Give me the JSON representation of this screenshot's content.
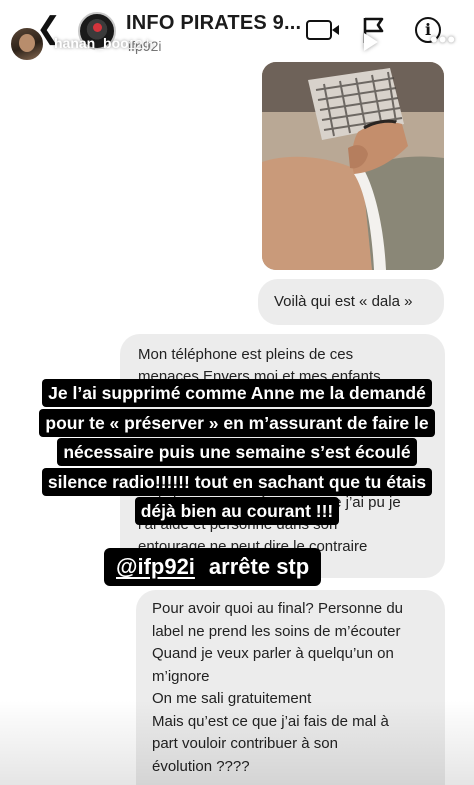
{
  "story": {
    "username": "hanan_boo",
    "time_label": "12 h",
    "progress_fraction": 1.0
  },
  "inner_chat": {
    "title": "INFO PIRATES 9...",
    "subtitle": "ifp92i"
  },
  "messages": {
    "dala": "Voilà qui est « dala »",
    "phone_top_1": "Mon téléphone est pleins de ces",
    "phone_top_2": "menaces Envers moi et mes enfants",
    "phone_bottom_1": "Je l’ai accompagné autant que j’ai pu je",
    "phone_bottom_2": "l’ai aidé et personne dans son",
    "phone_bottom_3": "entourage ne peut dire le contraire",
    "bottom_lines": [
      "Pour avoir quoi au final? Personne du",
      "label ne prend les soins de m’écouter",
      "Quand je veux parler à quelqu’un on",
      "m’ignore",
      "On me sali gratuitement",
      "Mais qu’est ce que j’ai fais de mal à",
      "part vouloir contribuer à son",
      "évolution ????"
    ]
  },
  "overlay": {
    "lines": [
      "Je l’ai supprimé comme Anne me la demandé",
      "pour te « préserver » en m’assurant de faire le",
      "nécessaire puis une semaine s’est écoulé",
      "silence radio!!!!!! tout en sachant que tu étais",
      "déjà bien au courant !!!"
    ],
    "mention": "@ifp92i",
    "mention_text": "arrête stp"
  },
  "icons": {
    "back": "chevron-left-icon",
    "video": "video-call-icon",
    "flag": "flag-icon",
    "info": "info-icon",
    "play": "play-icon",
    "mute": "mute-icon",
    "more": "more-icon"
  },
  "colors": {
    "bubble": "#ececec",
    "highlight": "#000000",
    "text": "#222222"
  }
}
